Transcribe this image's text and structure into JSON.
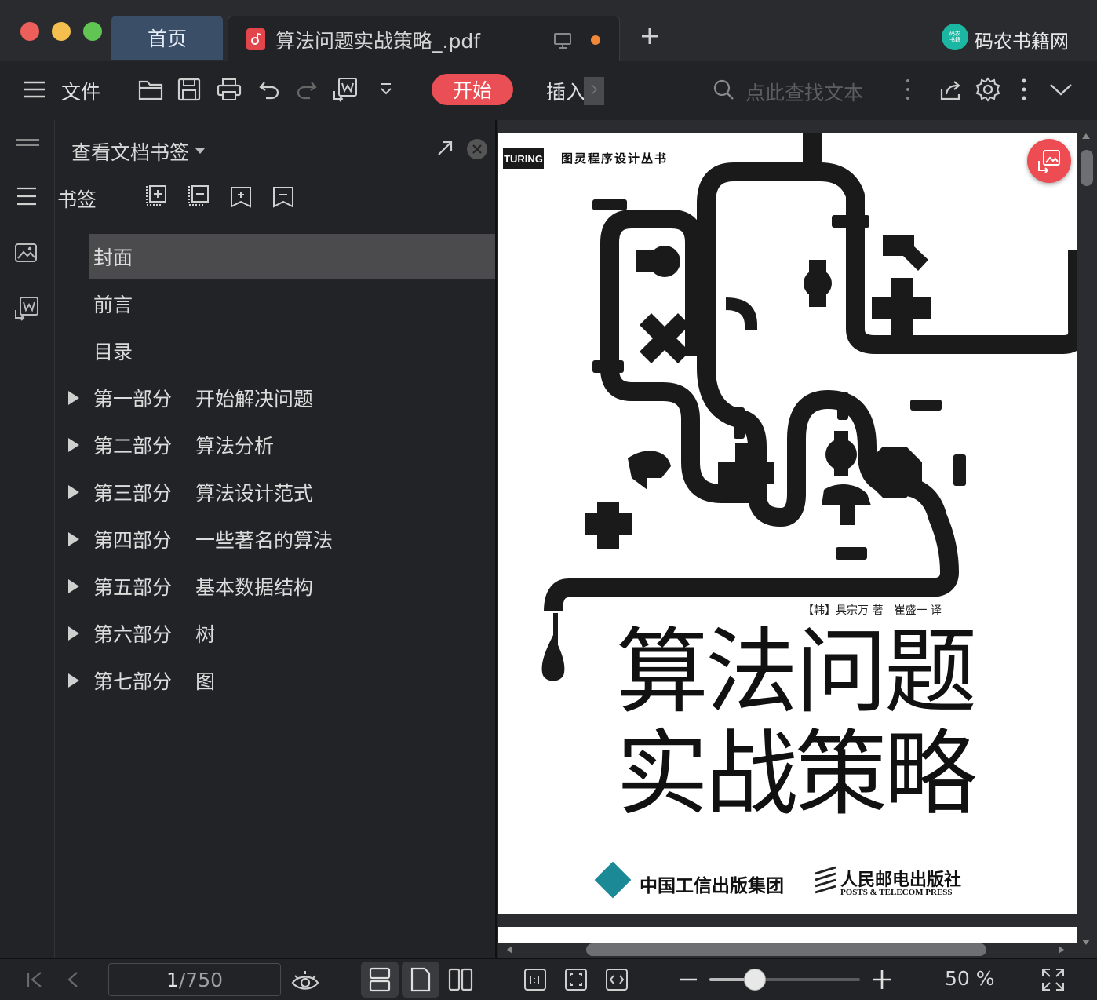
{
  "window": {
    "colors": {
      "close": "#ec5f5a",
      "minimize": "#f4bf4f",
      "maximize": "#61c554",
      "accent": "#e94f55"
    }
  },
  "tabs": {
    "home": "首页",
    "document": "算法问题实战策略_.pdf"
  },
  "brand": {
    "logo_text": "码农\n书籍",
    "name": "码农书籍网"
  },
  "toolbar": {
    "menu_label": "文件",
    "start_label": "开始",
    "insert_label": "插入",
    "search_placeholder": "点此查找文本"
  },
  "panel": {
    "header": "查看文档书签",
    "bookmarks_label": "书签",
    "items": [
      {
        "label": "封面",
        "sub": "",
        "expandable": false,
        "selected": true
      },
      {
        "label": "前言",
        "sub": "",
        "expandable": false,
        "selected": false
      },
      {
        "label": "目录",
        "sub": "",
        "expandable": false,
        "selected": false
      },
      {
        "label": "第一部分",
        "sub": "开始解决问题",
        "expandable": true,
        "selected": false
      },
      {
        "label": "第二部分",
        "sub": "算法分析",
        "expandable": true,
        "selected": false
      },
      {
        "label": "第三部分",
        "sub": "算法设计范式",
        "expandable": true,
        "selected": false
      },
      {
        "label": "第四部分",
        "sub": "一些著名的算法",
        "expandable": true,
        "selected": false
      },
      {
        "label": "第五部分",
        "sub": "基本数据结构",
        "expandable": true,
        "selected": false
      },
      {
        "label": "第六部分",
        "sub": "树",
        "expandable": true,
        "selected": false
      },
      {
        "label": "第七部分",
        "sub": "图",
        "expandable": true,
        "selected": false
      }
    ]
  },
  "cover": {
    "series_logo": "TURING",
    "series_name": "图灵程序设计丛书",
    "authors": "【韩】具宗万 著　崔盛一 译",
    "title_line1": "算法问题",
    "title_line2": "实战策略",
    "publisher1": "中国工信出版集团",
    "publisher2_cn": "人民邮电出版社",
    "publisher2_en": "POSTS & TELECOM PRESS"
  },
  "statusbar": {
    "current_page": "1",
    "total_pages": "/750",
    "zoom_value": "50",
    "zoom_unit": "%",
    "zoom_fraction": 0.3
  }
}
